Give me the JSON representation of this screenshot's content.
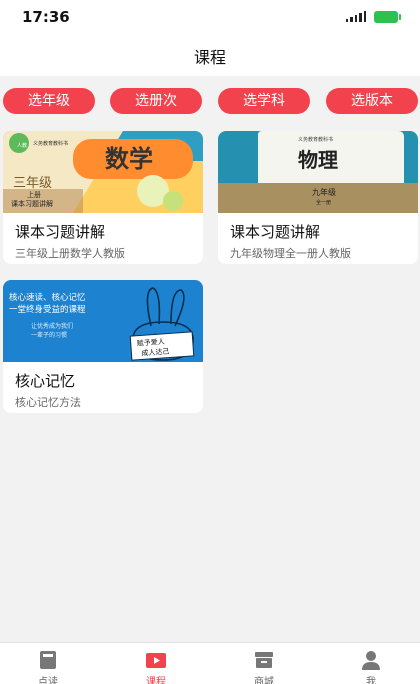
{
  "status_bar": {
    "time": "17:36"
  },
  "header": {
    "title": "课程"
  },
  "filters": [
    {
      "label": "选年级"
    },
    {
      "label": "选册次"
    },
    {
      "label": "选学科"
    },
    {
      "label": "选版本"
    }
  ],
  "courses": [
    {
      "title": "课本习题讲解",
      "subtitle": "三年级上册数学人教版",
      "cover": {
        "badge": "义务教育教科书",
        "subject": "数学",
        "grade": "三年级",
        "volume": "上册",
        "caption": "课本习题讲解"
      }
    },
    {
      "title": "课本习题讲解",
      "subtitle": "九年级物理全一册人教版",
      "cover": {
        "badge": "义务教育教科书",
        "subject": "物理",
        "grade": "九年级",
        "volume": "全一册"
      }
    },
    {
      "title": "核心记忆",
      "subtitle": "核心记忆方法",
      "cover": {
        "line1": "核心速读、核心记忆",
        "line2": "一堂终身受益的课程",
        "line3": "让优秀成为我们",
        "line4": "一辈子的习惯",
        "sign1": "赋予爱人",
        "sign2": "成人达己"
      }
    }
  ],
  "tabbar": [
    {
      "label": "点读",
      "icon": "book-icon"
    },
    {
      "label": "课程",
      "icon": "video-play-icon"
    },
    {
      "label": "商城",
      "icon": "store-icon"
    },
    {
      "label": "我",
      "icon": "person-icon"
    }
  ],
  "colors": {
    "accent": "#f2424e",
    "background": "#f2f2f2"
  }
}
